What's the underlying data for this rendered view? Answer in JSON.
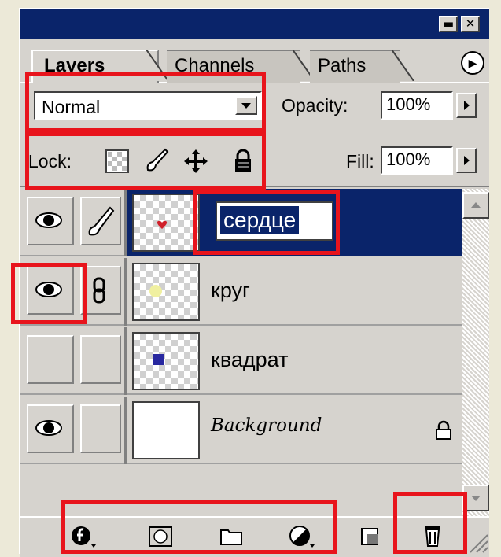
{
  "tabs": [
    {
      "label": "Layers"
    },
    {
      "label": "Channels"
    },
    {
      "label": "Paths"
    }
  ],
  "window_buttons": {
    "minimize": "▬",
    "close": "✕"
  },
  "blend_mode": {
    "value": "Normal"
  },
  "opacity": {
    "label": "Opacity:",
    "value": "100%"
  },
  "lock": {
    "label": "Lock:"
  },
  "fill": {
    "label": "Fill:",
    "value": "100%"
  },
  "layers": [
    {
      "name": "сердце",
      "visible": true,
      "selected": true,
      "editing": true,
      "thumb_mark_color": "#d0202a",
      "mode_icon": "brush-icon"
    },
    {
      "name": "круг",
      "visible": true,
      "selected": false,
      "thumb_mark_color": "#f0f0a0",
      "mode_icon": "chain-link-icon"
    },
    {
      "name": "квадрат",
      "visible": false,
      "selected": false,
      "thumb_mark_color": "#2828a0"
    },
    {
      "name": "Background",
      "visible": true,
      "selected": false,
      "locked": true
    }
  ],
  "bottom_icons": [
    "layer-style-icon",
    "layer-mask-icon",
    "layer-set-folder-icon",
    "adjustment-layer-icon",
    "new-layer-icon",
    "trash-icon"
  ],
  "colors": {
    "titlebar": "#0a246a",
    "selection": "#0a246a",
    "highlight": "#e8141c",
    "panel": "#d6d3ce"
  }
}
